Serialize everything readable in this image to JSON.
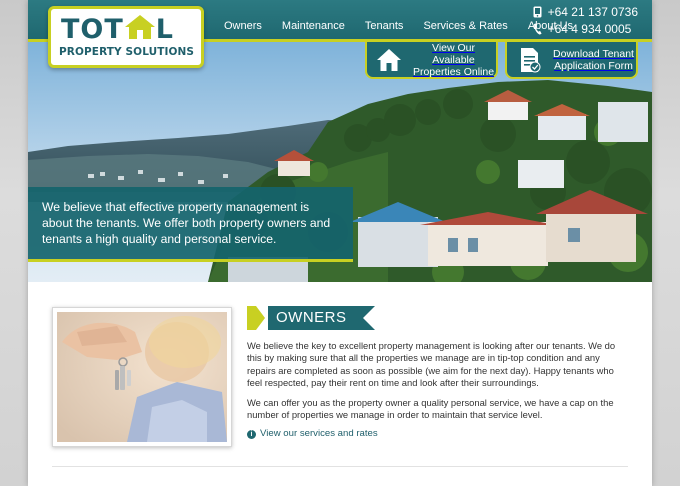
{
  "header": {
    "logo": {
      "word_left": "TOT",
      "word_right": "L",
      "subtitle": "PROPERTY SOLUTIONS"
    },
    "nav": [
      {
        "label": "Owners"
      },
      {
        "label": "Maintenance"
      },
      {
        "label": "Tenants"
      },
      {
        "label": "Services & Rates"
      },
      {
        "label": "About Us"
      }
    ],
    "phones": [
      "+64 21 137 0736",
      "+64 4 934 0005"
    ]
  },
  "cta": [
    {
      "label": "View Our Available Properties Online",
      "icon": "house-icon"
    },
    {
      "label": "Download Tenant Application Form",
      "icon": "document-icon"
    }
  ],
  "hero": {
    "tagline": "We believe that effective property management is about the tenants. We offer both property owners and tenants a high quality and personal service."
  },
  "owners": {
    "title": "OWNERS",
    "paragraphs": [
      "We believe the key to excellent property management is looking after our tenants. We do this by making sure that all the properties we manage are in tip-top condition and any repairs are completed as soon as possible (we aim for the next day). Happy tenants who feel respected, pay their rent on time and look after their surroundings.",
      "We can offer you as the property owner a quality personal service, we have a cap on the number of properties we manage in order to maintain that service level."
    ],
    "link": "View our services and rates"
  },
  "colors": {
    "brand_teal": "#1f6870",
    "accent_lime": "#c8d022"
  }
}
